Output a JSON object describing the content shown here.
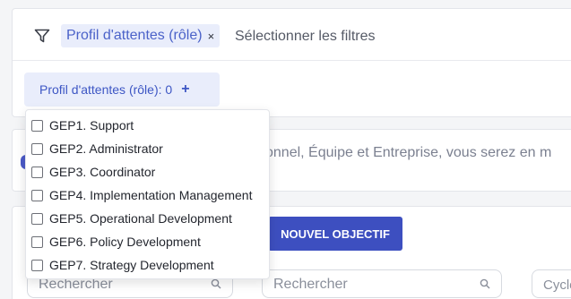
{
  "filter_bar": {
    "chip_label": "Profil d'attentes (rôle)",
    "chip_close": "×",
    "placeholder": "Sélectionner les filtres",
    "role_button_label": "Profil d'attentes (rôle): 0",
    "role_button_plus": "+"
  },
  "dropdown": {
    "options": [
      {
        "label": "GEP1. Support",
        "checked": false
      },
      {
        "label": "GEP2. Administrator",
        "checked": false
      },
      {
        "label": "GEP3. Coordinator",
        "checked": false
      },
      {
        "label": "GEP4. Implementation Management",
        "checked": false
      },
      {
        "label": "GEP5. Operational Development",
        "checked": false
      },
      {
        "label": "GEP6. Policy Development",
        "checked": false
      },
      {
        "label": "GEP7. Strategy Development",
        "checked": false
      }
    ]
  },
  "info_banner": {
    "text": "sonnel, Équipe et Entreprise, vous serez en m"
  },
  "objectives": {
    "new_button_label": "NOUVEL OBJECTIF",
    "search_left_placeholder": "Rechercher",
    "search_main_placeholder": "Rechercher",
    "cycle_placeholder": "Cycle"
  },
  "colors": {
    "accent": "#3d4fc0",
    "chip_bg": "#e9edfb",
    "chip_text": "#4b62c9"
  },
  "icons": {
    "filter": "funnel-icon",
    "search": "search-icon",
    "close": "close-icon",
    "add": "plus-icon"
  }
}
